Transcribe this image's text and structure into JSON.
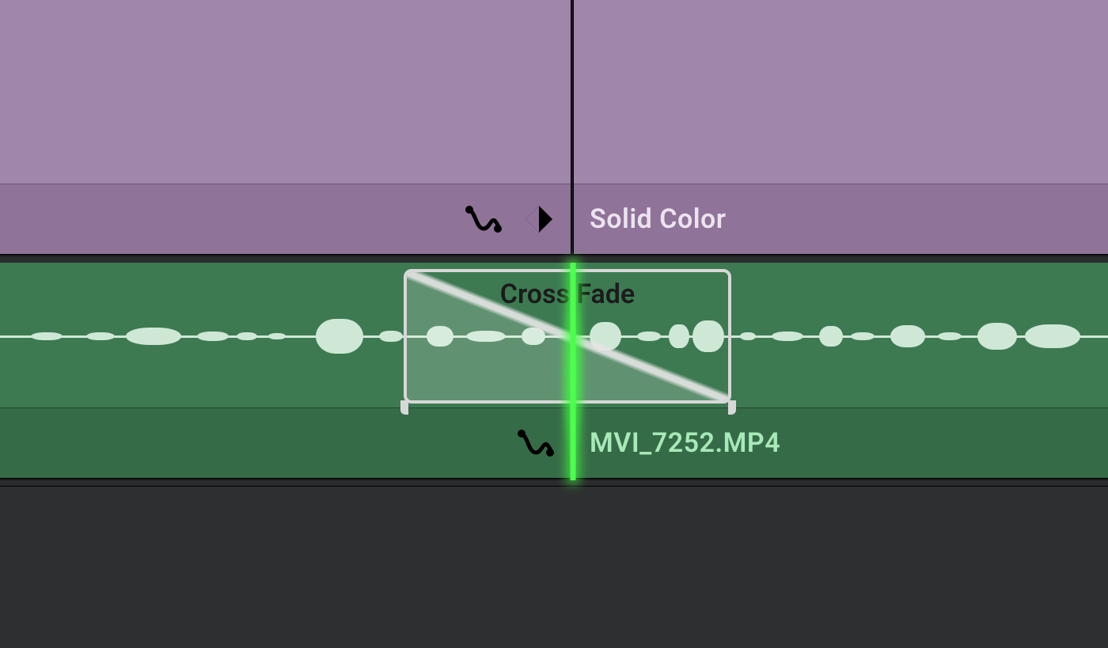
{
  "video_track": {
    "clip_left": {
      "title": ""
    },
    "clip_right": {
      "title": "Solid Color"
    },
    "keyframe_icon": "diamond-keyframe-icon",
    "curve_icon": "ease-curve-icon"
  },
  "audio_track": {
    "clip_left": {
      "title": ""
    },
    "clip_right": {
      "title": "MVI_7252.MP4"
    },
    "curve_icon": "ease-curve-icon"
  },
  "transition": {
    "label": "Cross Fade"
  },
  "colors": {
    "video_clip": "#a186ab",
    "video_band": "#8f7399",
    "audio_clip": "#3d7a52",
    "audio_band": "#366b48",
    "playhead": "#4dff4d",
    "waveform": "#cfe8d6"
  }
}
